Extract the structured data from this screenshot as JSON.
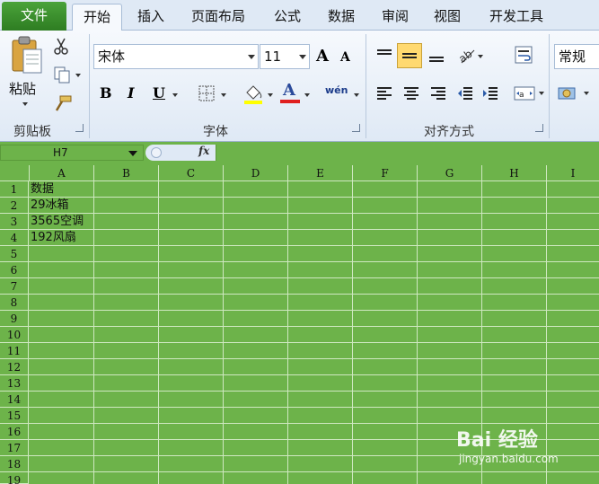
{
  "tabs": [
    "文件",
    "开始",
    "插入",
    "页面布局",
    "公式",
    "数据",
    "审阅",
    "视图",
    "开发工具"
  ],
  "ribbon": {
    "clipboard": {
      "paste_label": "粘贴",
      "group_label": "剪贴板"
    },
    "font": {
      "font_name": "宋体",
      "font_size": "11",
      "bold": "B",
      "italic": "I",
      "underline": "U",
      "font_color_glyph": "A",
      "grow_glyph": "A",
      "shrink_glyph": "A",
      "phonetic_glyph": "wén",
      "group_label": "字体"
    },
    "alignment": {
      "group_label": "对齐方式"
    },
    "number": {
      "format": "常规"
    }
  },
  "formula_bar": {
    "cell_ref": "H7",
    "fx_label": "fx",
    "content": ""
  },
  "grid": {
    "columns": [
      "A",
      "B",
      "C",
      "D",
      "E",
      "F",
      "G",
      "H",
      "I"
    ],
    "rows": [
      "1",
      "2",
      "3",
      "4",
      "5",
      "6",
      "7",
      "8",
      "9",
      "10",
      "11",
      "12",
      "13",
      "14",
      "15",
      "16",
      "17",
      "18",
      "19"
    ],
    "cells": [
      "数据",
      "29冰箱",
      "3565空调",
      "192风扇"
    ]
  },
  "watermark": {
    "main": "Bai 经验",
    "sub": "jingyan.baidu.com"
  },
  "colors": {
    "sheet_bg": "#6db34a",
    "gridline": "#cfe8c1",
    "file_tab": "#2e7d22"
  }
}
